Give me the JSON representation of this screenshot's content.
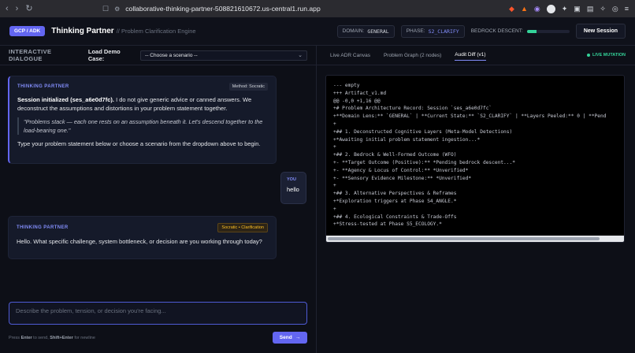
{
  "browser": {
    "url": "collaborative-thinking-partner-508821610672.us-central1.run.app"
  },
  "header": {
    "badge": "GCP / ADK",
    "title": "Thinking Partner",
    "subtitle": "// Problem Clarification Engine",
    "domain_label": "DOMAIN:",
    "domain_value": "GENERAL",
    "phase_label": "PHASE:",
    "phase_value": "S2_CLARIFY",
    "bedrock_label": "BEDROCK DESCENT:",
    "bedrock_progress": 0.22,
    "new_session": "New Session"
  },
  "left": {
    "pane_label": "INTERACTIVE DIALOGUE",
    "demo_label": "Load Demo Case:",
    "demo_selected": "-- Choose a scenario --",
    "messages": [
      {
        "sender": "THINKING PARTNER",
        "badge": "Method: Socratic",
        "intro_bold": "Session initialized (ses_a6e0d7fc).",
        "intro_rest": " I do not give generic advice or canned answers. We deconstruct the assumptions and distortions in your problem statement together.",
        "quote": "\"Problems stack — each one rests on an assumption beneath it. Let's descend together to the load-bearing one.\"",
        "outro": "Type your problem statement below or choose a scenario from the dropdown above to begin."
      },
      {
        "sender": "YOU",
        "text": "hello"
      },
      {
        "sender": "THINKING PARTNER",
        "badge": "Socratic • Clarification",
        "text": "Hello. What specific challenge, system bottleneck, or decision are you working through today?"
      }
    ],
    "composer_placeholder": "Describe the problem, tension, or decision you're facing...",
    "hint_press": "Press ",
    "hint_enter": "Enter",
    "hint_mid": " to send, ",
    "hint_shift": "Shift+Enter",
    "hint_end": " for newline",
    "send_label": "Send"
  },
  "right": {
    "tabs": [
      "Live ADR Canvas",
      "Problem Graph (2 nodes)",
      "Audit Diff (v1)"
    ],
    "live_label": "LIVE MUTATION",
    "diff_lines": [
      "--- empty",
      "+++ Artifact_v1.md",
      "@@ -0,0 +1,16 @@",
      "+# Problem Architecture Record: Session `ses_a6e0d7fc`",
      "+**Domain Lens:** `GENERAL` | **Current State:** `S2_CLARIFY` | **Layers Peeled:** 0 | **Pend",
      "+",
      "+## 1. Deconstructed Cognitive Layers (Meta-Model Detections)",
      "+*Awaiting initial problem statement ingestion...*",
      "+",
      "+## 2. Bedrock & Well-Formed Outcome (WFO)",
      "+- **Target Outcome (Positive):** *Pending bedrock descent...*",
      "+- **Agency & Locus of Control:** *Unverified*",
      "+- **Sensory Evidence Milestone:** *Unverified*",
      "+",
      "+## 3. Alternative Perspectives & Reframes",
      "+*Exploration triggers at Phase S4_ANGLE.*",
      "+",
      "+## 4. Ecological Constraints & Trade-Offs",
      "+*Stress-tested at Phase S5_ECOLOGY.*"
    ]
  }
}
